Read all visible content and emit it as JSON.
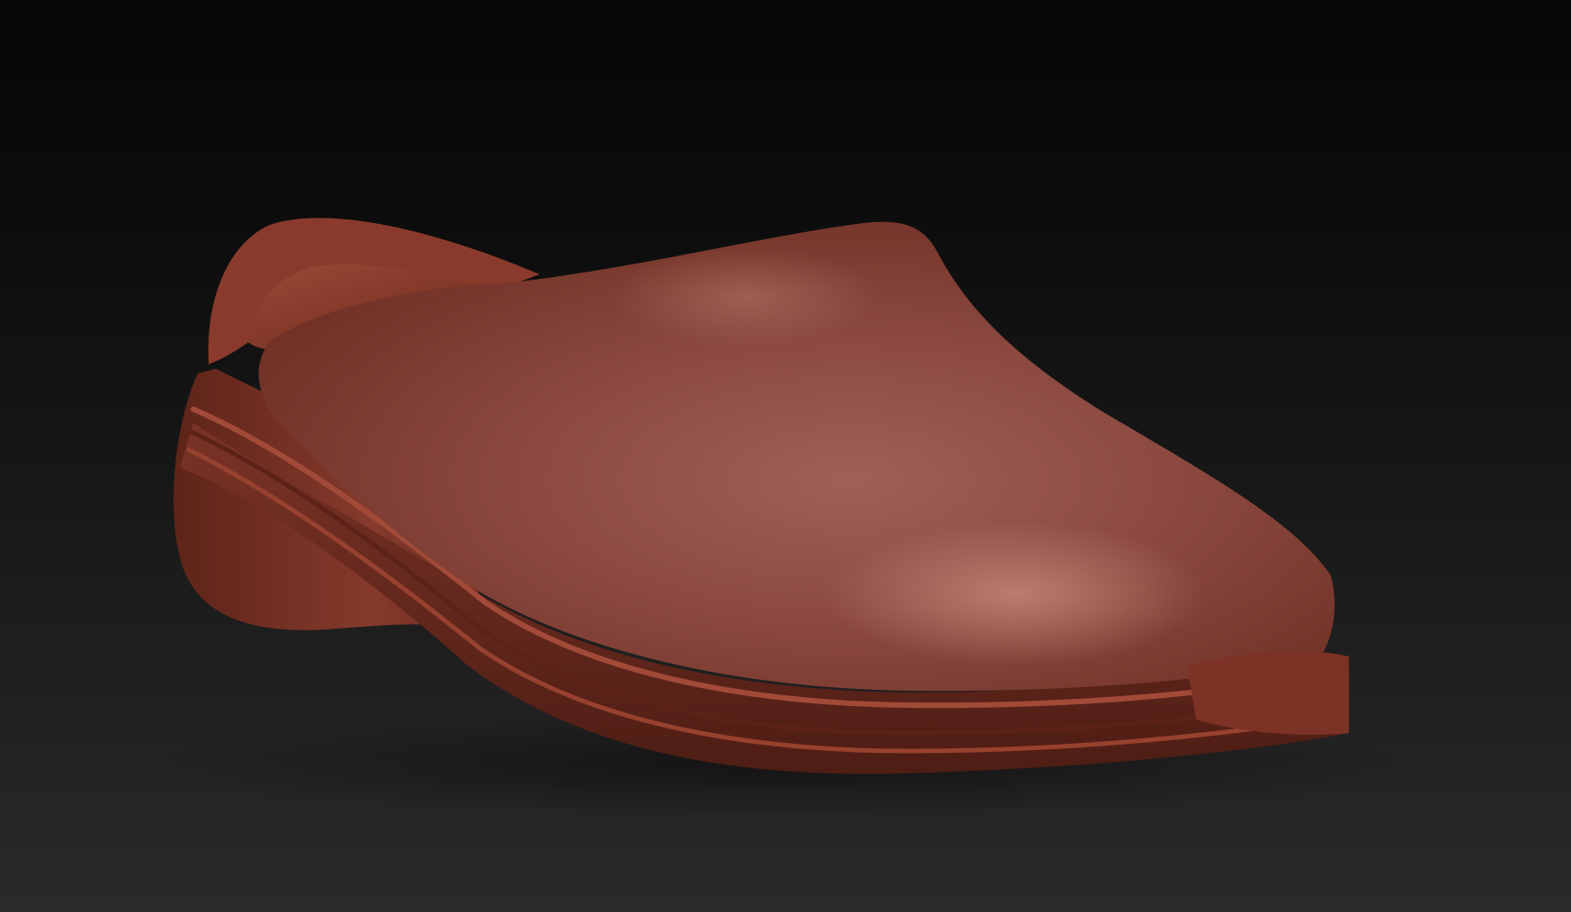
{
  "viewport": {
    "background_top": "#060606",
    "background_bottom": "#2a2a2a"
  },
  "model": {
    "object": "clog-shoe",
    "material_base_color": "#8a3a2a",
    "material_highlight_color": "#b06858",
    "material_shadow_color": "#4a1c14"
  }
}
